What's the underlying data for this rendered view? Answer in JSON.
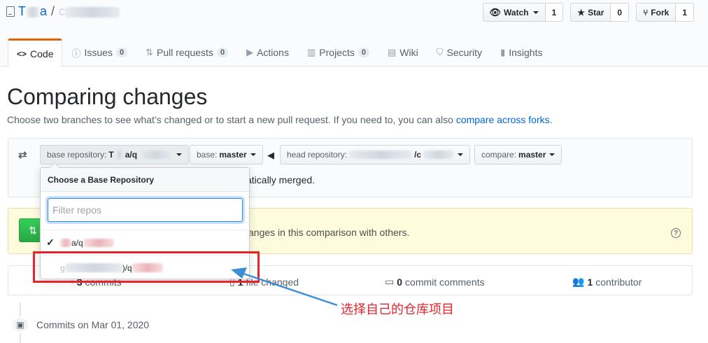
{
  "repo": {
    "owner_visible": "T",
    "owner_tail": "a",
    "separator": "/",
    "name_visible": "c"
  },
  "actions": {
    "watch": {
      "label": "Watch",
      "count": "1"
    },
    "star": {
      "label": "Star",
      "count": "0"
    },
    "fork": {
      "label": "Fork",
      "count": "1"
    }
  },
  "nav": [
    {
      "label": "Code",
      "icon": "code-icon",
      "selected": true
    },
    {
      "label": "Issues",
      "icon": "issue-icon",
      "count": "0"
    },
    {
      "label": "Pull requests",
      "icon": "pull-request-icon",
      "count": "0"
    },
    {
      "label": "Actions",
      "icon": "play-icon"
    },
    {
      "label": "Projects",
      "icon": "project-icon",
      "count": "0"
    },
    {
      "label": "Wiki",
      "icon": "book-icon"
    },
    {
      "label": "Security",
      "icon": "shield-icon"
    },
    {
      "label": "Insights",
      "icon": "graph-icon"
    }
  ],
  "page": {
    "title": "Comparing changes",
    "subtitle": "Choose two branches to see what’s changed or to start a new pull request. If you need to, you can also ",
    "subtitle_link": "compare across forks",
    "subtitle_end": "."
  },
  "range": {
    "base_repo_label": "base repository:",
    "base_repo_value_a": "T",
    "base_repo_value_b": "a/q",
    "base_label": "base:",
    "base_value": "master",
    "head_repo_label": "head repository:",
    "head_repo_value_mid": "/c",
    "compare_label": "compare:",
    "compare_value": "master",
    "merge_status": "atically merged."
  },
  "dropdown": {
    "header": "Choose a Base Repository",
    "filter_placeholder": "Filter repos",
    "items": [
      {
        "prefix": "",
        "text": "a/q",
        "checked": true
      },
      {
        "prefix": "g",
        "text": ")/q",
        "checked": false
      }
    ]
  },
  "flash": {
    "text": "anges in this comparison with others."
  },
  "summary": {
    "commits_count": "3",
    "commits_label": "commits",
    "files_count": "1",
    "files_label": "file changed",
    "comments_count": "0",
    "comments_label": "commit comments",
    "contributors_count": "1",
    "contributors_label": "contributor"
  },
  "timeline": {
    "text": "Commits on Mar 01, 2020"
  },
  "annotation": {
    "text": "选择自己的仓库项目",
    "color": "#e8232c"
  }
}
